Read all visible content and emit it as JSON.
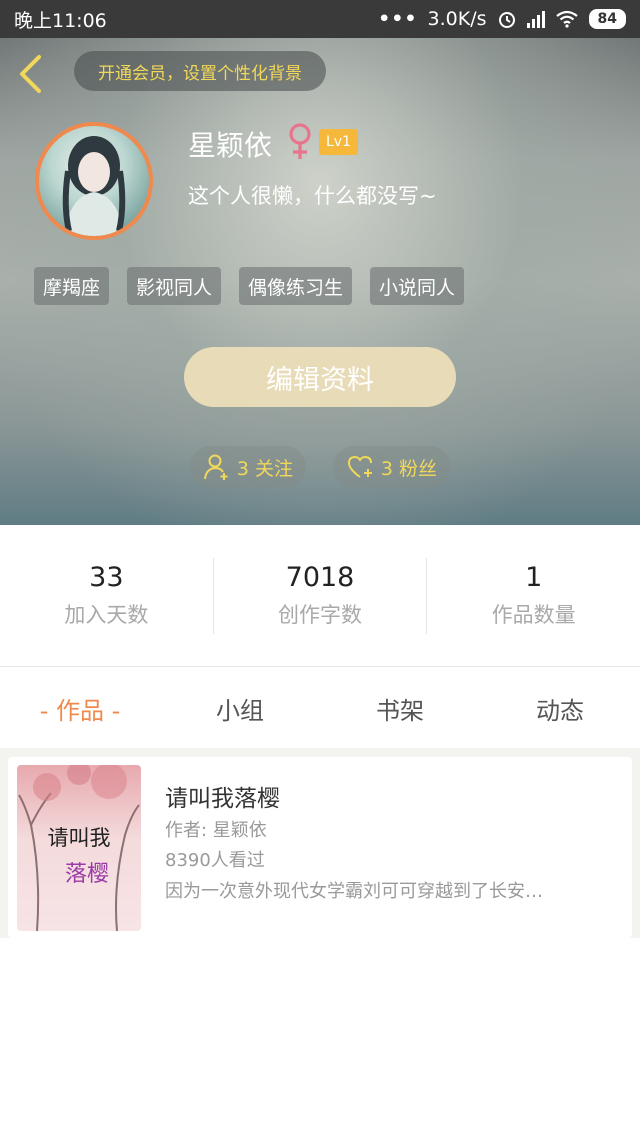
{
  "status_bar": {
    "time": "晚上11:06",
    "network_speed": "3.0K/s",
    "battery": "84",
    "icons": [
      "dots-icon",
      "alarm-icon",
      "signal-icon",
      "wifi-icon",
      "battery-icon"
    ]
  },
  "header": {
    "back_icon": "chevron-left-icon",
    "vip_text": "开通会员，设置个性化背景",
    "username": "星颖依",
    "gender_icon": "female-icon",
    "level": "Lv1",
    "bio": "这个人很懒，什么都没写~",
    "tags": [
      "摩羯座",
      "影视同人",
      "偶像练习生",
      "小说同人"
    ],
    "edit_button": "编辑资料",
    "follows": {
      "icon": "add-user-icon",
      "label": "3 关注"
    },
    "fans": {
      "icon": "heart-add-icon",
      "label": "3 粉丝"
    },
    "accent_color": "#f2d85a"
  },
  "stats": [
    {
      "value": "33",
      "label": "加入天数"
    },
    {
      "value": "7018",
      "label": "创作字数"
    },
    {
      "value": "1",
      "label": "作品数量"
    }
  ],
  "tabs": [
    {
      "label": "- 作品 -",
      "active": true
    },
    {
      "label": "小组",
      "active": false
    },
    {
      "label": "书架",
      "active": false
    },
    {
      "label": "动态",
      "active": false
    }
  ],
  "works": [
    {
      "cover_text_line1": "请叫我",
      "cover_text_line2": "落樱",
      "title": "请叫我落樱",
      "author": "作者: 星颖依",
      "views": "8390人看过",
      "description": "因为一次意外现代女学霸刘可可穿越到了长安…"
    }
  ],
  "colors": {
    "active_tab": "#f0894e",
    "avatar_border": "#f0894e",
    "level_badge": "#f5b83a",
    "edit_button": "#e8dbb7"
  }
}
